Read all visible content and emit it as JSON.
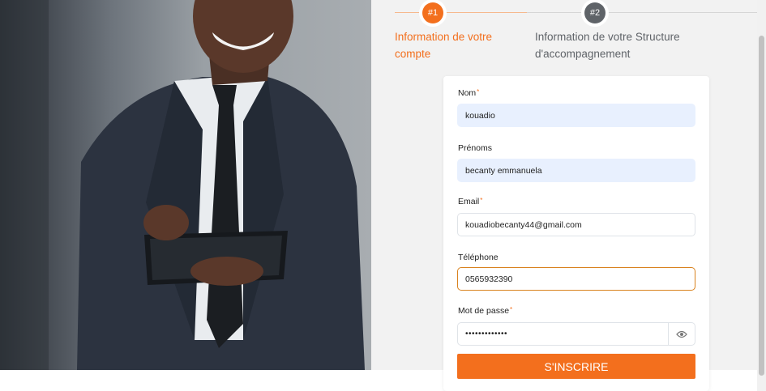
{
  "colors": {
    "accent": "#f36f1d",
    "step_inactive": "#5f6368",
    "autofill_bg": "#e8f0fe",
    "focus_border": "#d9821e"
  },
  "stepper": {
    "steps": [
      {
        "number": "#1",
        "label_line1": "Information de votre",
        "label_line2": "compte",
        "state": "active"
      },
      {
        "number": "#2",
        "label_line1": "Information de votre Structure",
        "label_line2": "d'accompagnement",
        "state": "inactive"
      }
    ]
  },
  "form": {
    "fields": {
      "nom": {
        "label": "Nom",
        "required": "*",
        "value": "kouadio"
      },
      "prenoms": {
        "label": "Prénoms",
        "value": "becanty emmanuela"
      },
      "email": {
        "label": "Email",
        "required": "*",
        "value": "kouadiobecanty44@gmail.com"
      },
      "telephone": {
        "label": "Téléphone",
        "value": "0565932390"
      },
      "password": {
        "label": "Mot de passe",
        "required": "*",
        "value": "•••••••••••••",
        "toggle_icon": "eye-icon"
      }
    },
    "submit_label": "S'INSCRIRE"
  }
}
